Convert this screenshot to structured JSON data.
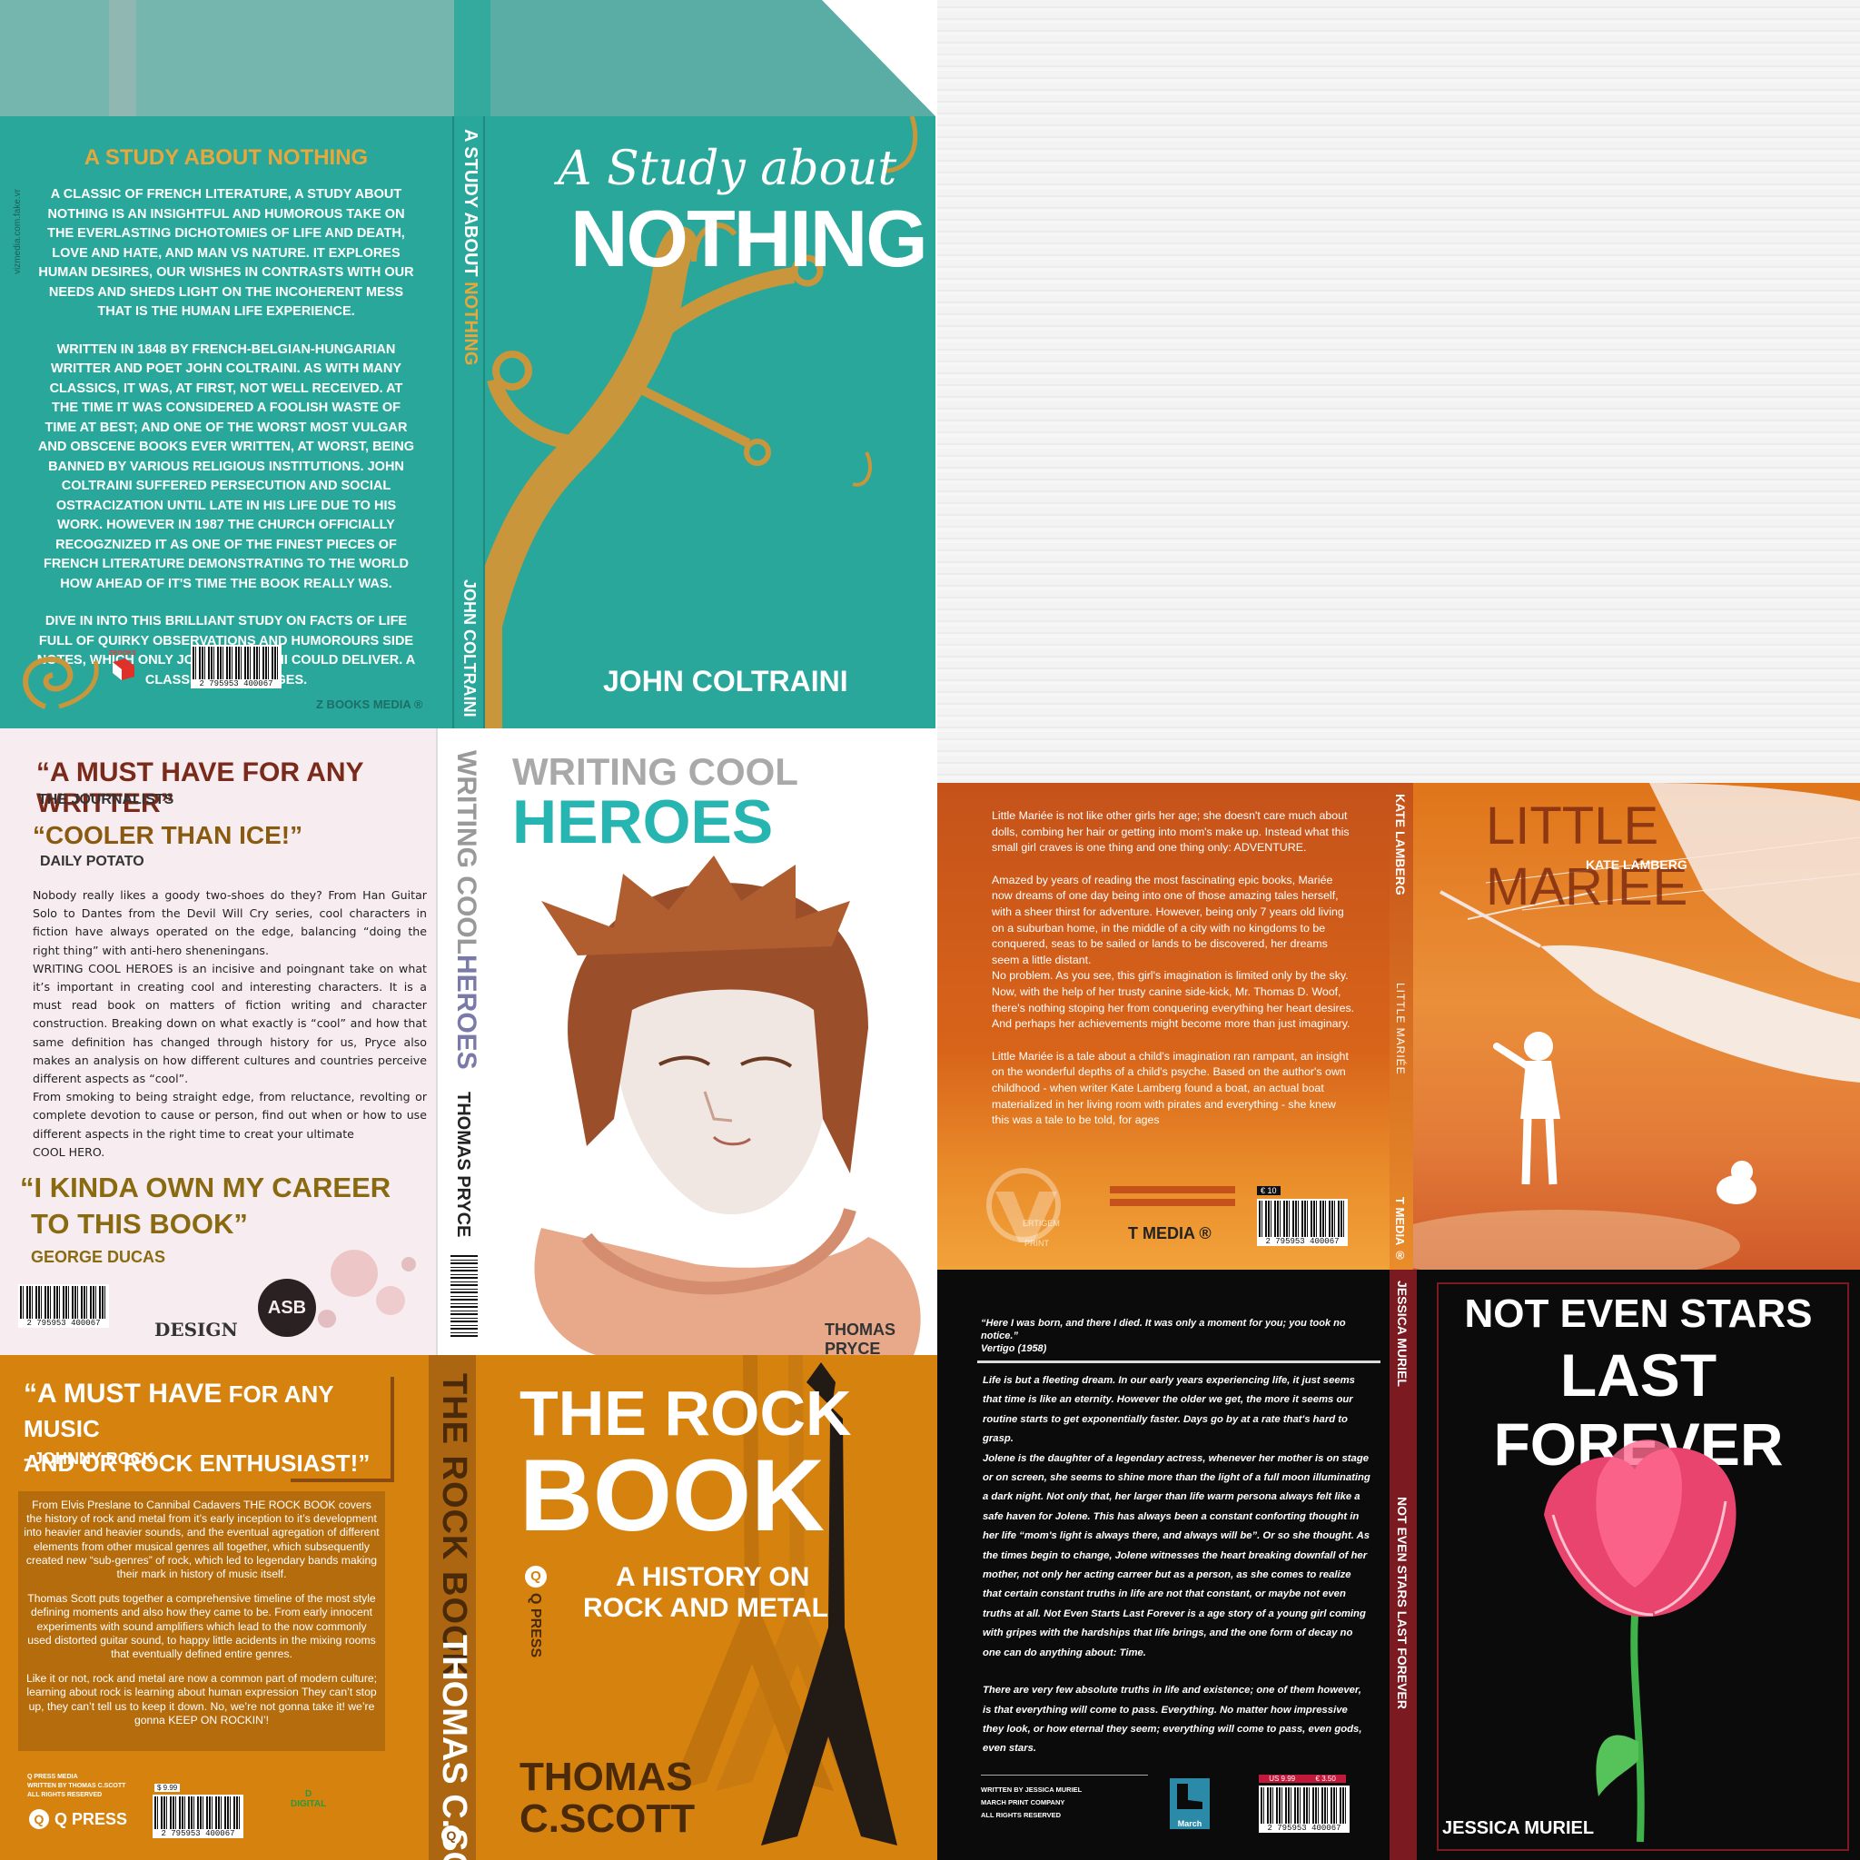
{
  "colors": {
    "teal": "#2aa79b",
    "teal_dark": "#17877d",
    "gold": "#c9963b",
    "pink_bg": "#f7ecef",
    "orange": "#e0751a",
    "orange_dark": "#c5521a",
    "amber": "#d6820f",
    "black": "#0b0b0b",
    "crimson": "#7b1a20"
  },
  "nothing": {
    "back_title": "A STUDY ABOUT NOTHING",
    "back_p1": "A CLASSIC OF FRENCH LITERATURE, A STUDY ABOUT NOTHING IS AN INSIGHTFUL AND HUMOROUS TAKE ON THE EVERLASTING DICHOTOMIES OF LIFE AND DEATH, LOVE AND HATE, AND MAN VS NATURE. IT EXPLORES HUMAN DESIRES, OUR WISHES IN CONTRASTS WITH OUR NEEDS AND SHEDS LIGHT ON THE INCOHERENT MESS THAT IS THE HUMAN LIFE EXPERIENCE.",
    "back_p2": "WRITTEN IN 1848 BY FRENCH-BELGIAN-HUNGARIAN WRITTER AND POET JOHN COLTRAINI. AS WITH MANY CLASSICS, IT WAS, AT FIRST, NOT WELL RECEIVED. AT THE TIME IT WAS CONSIDERED A FOOLISH WASTE OF TIME AT BEST; AND ONE OF THE WORST MOST VULGAR AND OBSCENE BOOKS EVER WRITTEN, AT WORST, BEING BANNED BY VARIOUS RELIGIOUS INSTITUTIONS. JOHN COLTRAINI SUFFERED PERSECUTION AND SOCIAL OSTRACIZATION UNTIL LATE IN HIS LIFE DUE TO HIS WORK. HOWEVER IN 1987 THE CHURCH OFFICIALLY RECOGZNIZED IT AS ONE OF THE FINEST PIECES OF FRENCH LITERATURE DEMONSTRATING TO THE WORLD HOW AHEAD OF IT'S TIME THE BOOK REALLY WAS.",
    "back_p3": "DIVE IN INTO THIS BRILLIANT STUDY ON FACTS OF LIFE FULL OF QUIRKY OBSERVATIONS AND HUMOROURS SIDE NOTES, WHICH ONLY JOHN COLTRAINI COULD DELIVER. A CLASSIC FOR ALL AGES.",
    "side_credit": "vizmedia.com.fake.vr",
    "publisher": "Z BOOKS MEDIA ®",
    "logo_text": "ZBOOKS",
    "barcode_number": "2 795953 400067",
    "spine_title_a": "A STUDY ABOUT ",
    "spine_title_b": "NOTHING",
    "spine_author": "JOHN COLTRAINI",
    "cover_script": "A Study about",
    "cover_title": "NOTHING",
    "cover_author": "JOHN COLTRAINI"
  },
  "heroes": {
    "quote1": "“A MUST HAVE FOR ANY WRITTER”",
    "quote1_source": "THE JOURNALISTS",
    "quote2": "“COOLER THAN ICE!”",
    "quote2_source": "DAILY POTATO",
    "body_p1": "Nobody really likes a goody two-shoes do they? From Han Guitar Solo to Dantes from the Devil Will Cry series, cool characters in fiction have always operated on the edge, balancing “doing the right thing” with anti-hero sheneningans.",
    "body_p2": "WRITING COOL HEROES is an incisive and poingnant take on what it’s important in creating cool and interesting characters. It is a must read book on matters of fiction writing and character construction. Breaking down on what exactly is “cool” and how that same definition has changed through history for us, Pryce also makes an analysis on how different cultures and countries perceive different aspects as “cool”.",
    "body_p3": "From smoking to being straight edge, from reluctance, revolting or complete devotion to cause or person, find out when or how to use different aspects in the right time to creat your ultimate",
    "body_p3_end": "COOL HERO.",
    "quote3_l1": "“I KINDA OWN MY CAREER",
    "quote3_l2": "TO THIS BOOK”",
    "quote3_source": "GEORGE DUCAS",
    "design_label": "DESIGN",
    "logo_letters": "ASB",
    "barcode_number": "2 795953 400067",
    "spine_title_a": "WRITING COOL",
    "spine_title_b": "HEROES",
    "spine_author": "THOMAS PRYCE",
    "cover_title_a": "WRITING COOL",
    "cover_title_b": "HEROES",
    "cover_author": "THOMAS PRYCE"
  },
  "rock": {
    "quote_a": "“A MUST HAVE",
    "quote_b": " FOR ANY MUSIC",
    "quote_c": "AND OR ROCK ENTHUSIAST!”",
    "quote_source": "- JOHNNY ROCK",
    "body_p1": "From Elvis Preslane to Cannibal Cadavers THE ROCK BOOK covers the history of rock and metal from it’s early inception to it’s development into heavier and heavier sounds, and the eventual agregation of different elements from other musical genres all together, which subsequently created new “sub-genres” of rock, which led to legendary bands making their mark in history of music itself.",
    "body_p2": "Thomas Scott puts together a comprehensive timeline of the most style defining moments and also how they came to be. From early innocent experiments with sound amplifiers which lead to the now commonly used distorted guitar sound, to happy little acidents in the mixing rooms that eventually defined entire genres.",
    "body_p3": "Like it or not, rock and metal are now a common part of modern culture; learning about rock is learning about human expression They can’t stop up, they can’t tell us to keep it down. No, we’re not gonna take it! we’re gonna KEEP ON ROCKIN’!",
    "imprint_l1": "Q PRESS MEDIA",
    "imprint_l2": "WRITTEN BY THOMAS C.SCOTT",
    "imprint_l3": "ALL RIGHTS RESERVED",
    "qpress_label": "Q PRESS",
    "digital_d": "D",
    "digital_label": "DIGITAL",
    "price": "$ 9.99",
    "barcode_number": "2 795953 400067",
    "spine_title": "THE ROCK BOOK",
    "spine_author": "THOMAS C.SCOTT",
    "cover_title_a": "THE ROCK",
    "cover_title_b": "BOOK",
    "cover_subtitle_a": "A HISTORY ON",
    "cover_subtitle_b": "ROCK AND METAL",
    "cover_press": "Q PRESS",
    "cover_author_a": "THOMAS",
    "cover_author_b": "C.SCOTT"
  },
  "mariee": {
    "body_p1": "Little Mariée is not like other girls her age; she doesn't care much about dolls, combing her hair or getting into mom's make up. Instead what this small girl craves is one thing and one thing only: ADVENTURE.",
    "body_p2": "Amazed by years of reading the most fascinating epic books, Mariée now dreams of one day being into one of those amazing tales herself, with a sheer thirst for adventure. However, being only 7 years old living on a suburban home, in the middle of a city with no kingdoms to be conquered, seas to be sailed or lands to be discovered, her dreams seem a little distant.",
    "body_p3": "No problem. As you see, this girl's imagination is limited only by the sky. Now, with the help of her trusty canine side-kick, Mr. Thomas D. Woof, there's nothing stoping her from conquering everything her heart desires. And perhaps her achievements might become more than just imaginary.",
    "body_p4": "Little Mariée is a tale about a child's imagination ran rampant, an insight on the wonderful depths of a child's psyche. Based on the author's own childhood - when writer Kate Lamberg found a boat, an actual boat materialized in her living room with pirates and everything - she knew this was a tale to be told, for ages",
    "vertigem_v": "V",
    "vertigem_a": "ERTIGEM",
    "vertigem_b": "PRINT",
    "tmedia": "T MEDIA ®",
    "price": "€ 10",
    "barcode_number": "2 795953 400067",
    "spine_author": "KATE LAMBERG",
    "spine_title": "LITTLE MARIÉE",
    "spine_publisher": "T MEDIA ®",
    "cover_title": "LITTLE MARIÉE",
    "cover_author": "KATE LAMBERG"
  },
  "stars": {
    "quote": "“Here I was born, and there I died. It was only a moment for you;  you took no notice.”",
    "quote_source": "Vertigo (1958)",
    "body_p1": "Life is but a fleeting dream. In our early years experiencing life, it just seems that time is like an eternity. However the older we get, the more it seems our routine starts to get exponentially faster. Days go by at a rate that's hard to grasp.",
    "body_p2": "Jolene is the daughter of a legendary actress, whenever her mother is on stage or on screen, she seems to shine more than the light of a full moon illuminating a dark night. Not only that, her larger than life warm persona always felt like a safe haven for Jolene. This has always been a constant conforting thought in her life “mom's light is always there, and always will be”. Or so she thought. As the times begin to change, Jolene witnesses the heart breaking downfall of her mother, not only her acting carreer but as a person, as she comes to realize that certain constant truths in life are not that constant, or maybe not even truths at all. Not Even Starts Last Forever is a age story of a young girl coming with gripes with the hardships that life brings, and the one form of decay no one can do anything about: Time.",
    "body_p3": "There are very few absolute truths in life and existence; one of them however, is that everything will come to pass. Everything. No matter how impressive they look, or how eternal they seem; everything will come to pass, even gods, even stars.",
    "credit_l1": "WRITTEN BY JESSICA MURIEL",
    "credit_l2": "MARCH PRINT COMPANY",
    "credit_l3": "ALL RIGHTS RESERVED",
    "march_label": "March",
    "price_us": "US 9.99",
    "price_eu": "€ 3.50",
    "barcode_number": "2 795953 400067",
    "spine_author": "JESSICA MURIEL",
    "spine_title": "NOT EVEN STARS LAST FOREVER",
    "cover_title_a": "NOT EVEN STARS",
    "cover_title_b": "LAST FOREVER",
    "cover_author": "JESSICA MURIEL"
  }
}
